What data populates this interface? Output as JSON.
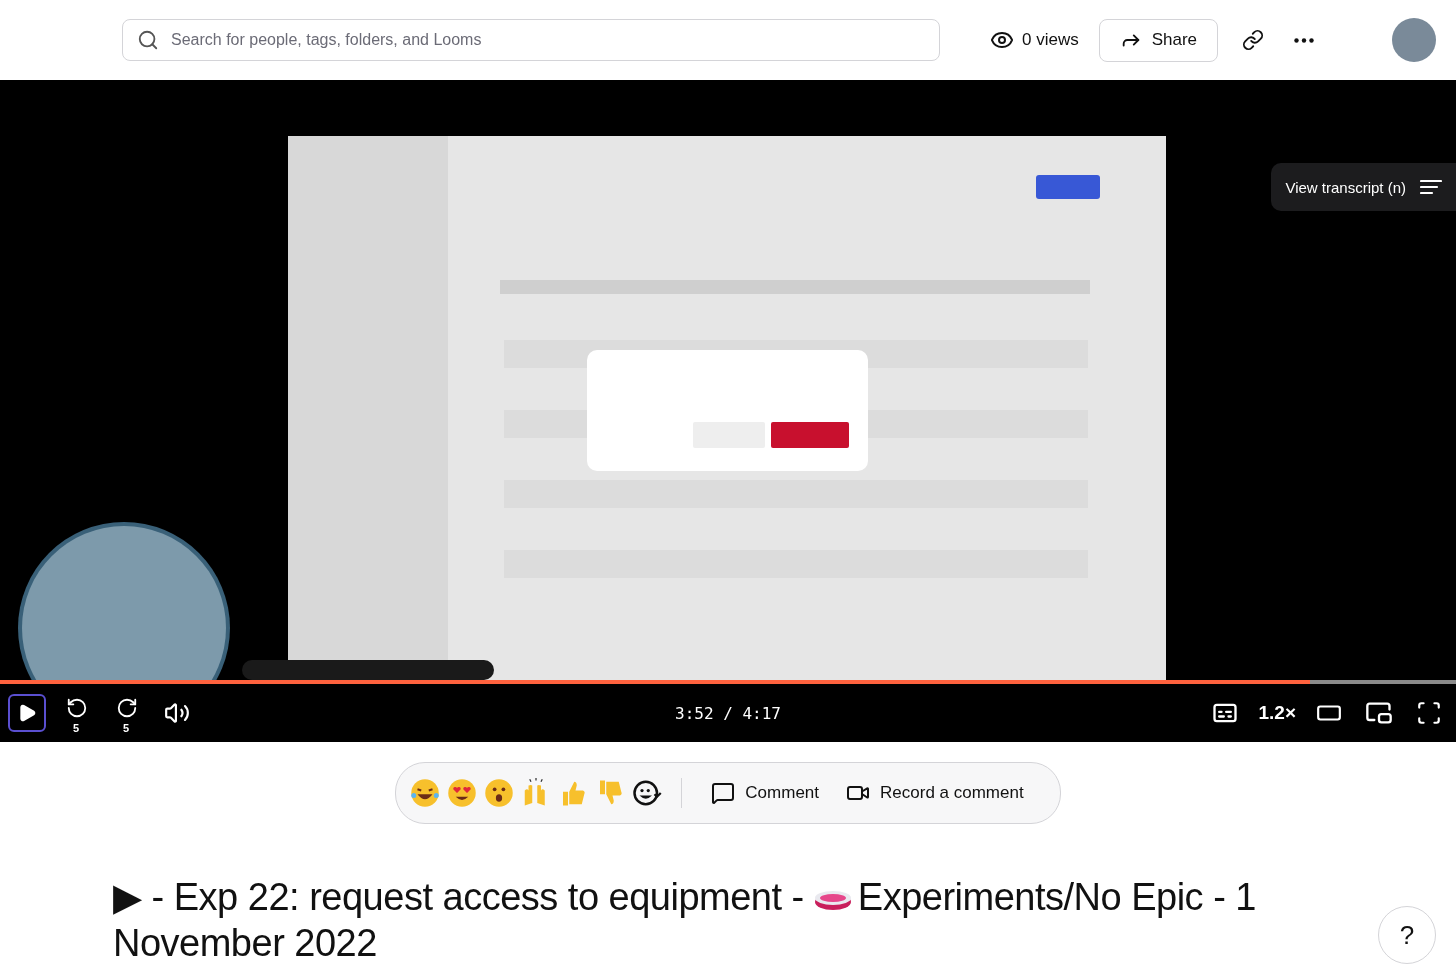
{
  "search": {
    "placeholder": "Search for people, tags, folders, and Looms"
  },
  "views": "0 views",
  "share": "Share",
  "player": {
    "transcript_button": "View transcript (n)",
    "progress": {
      "level": 0.9
    },
    "skip_back": "5",
    "skip_forward": "5",
    "time": "3:52 / 4:17",
    "speed": "1.2×"
  },
  "actions": [
    {
      "kind": "comment",
      "label": "Comment"
    },
    {
      "kind": "record",
      "label": "Record a comment"
    }
  ],
  "title": {
    "before": "▶ - Exp 22: request access to equipment - ",
    "after": "Experiments/No Epic - 1 November 2022"
  },
  "help": "?"
}
